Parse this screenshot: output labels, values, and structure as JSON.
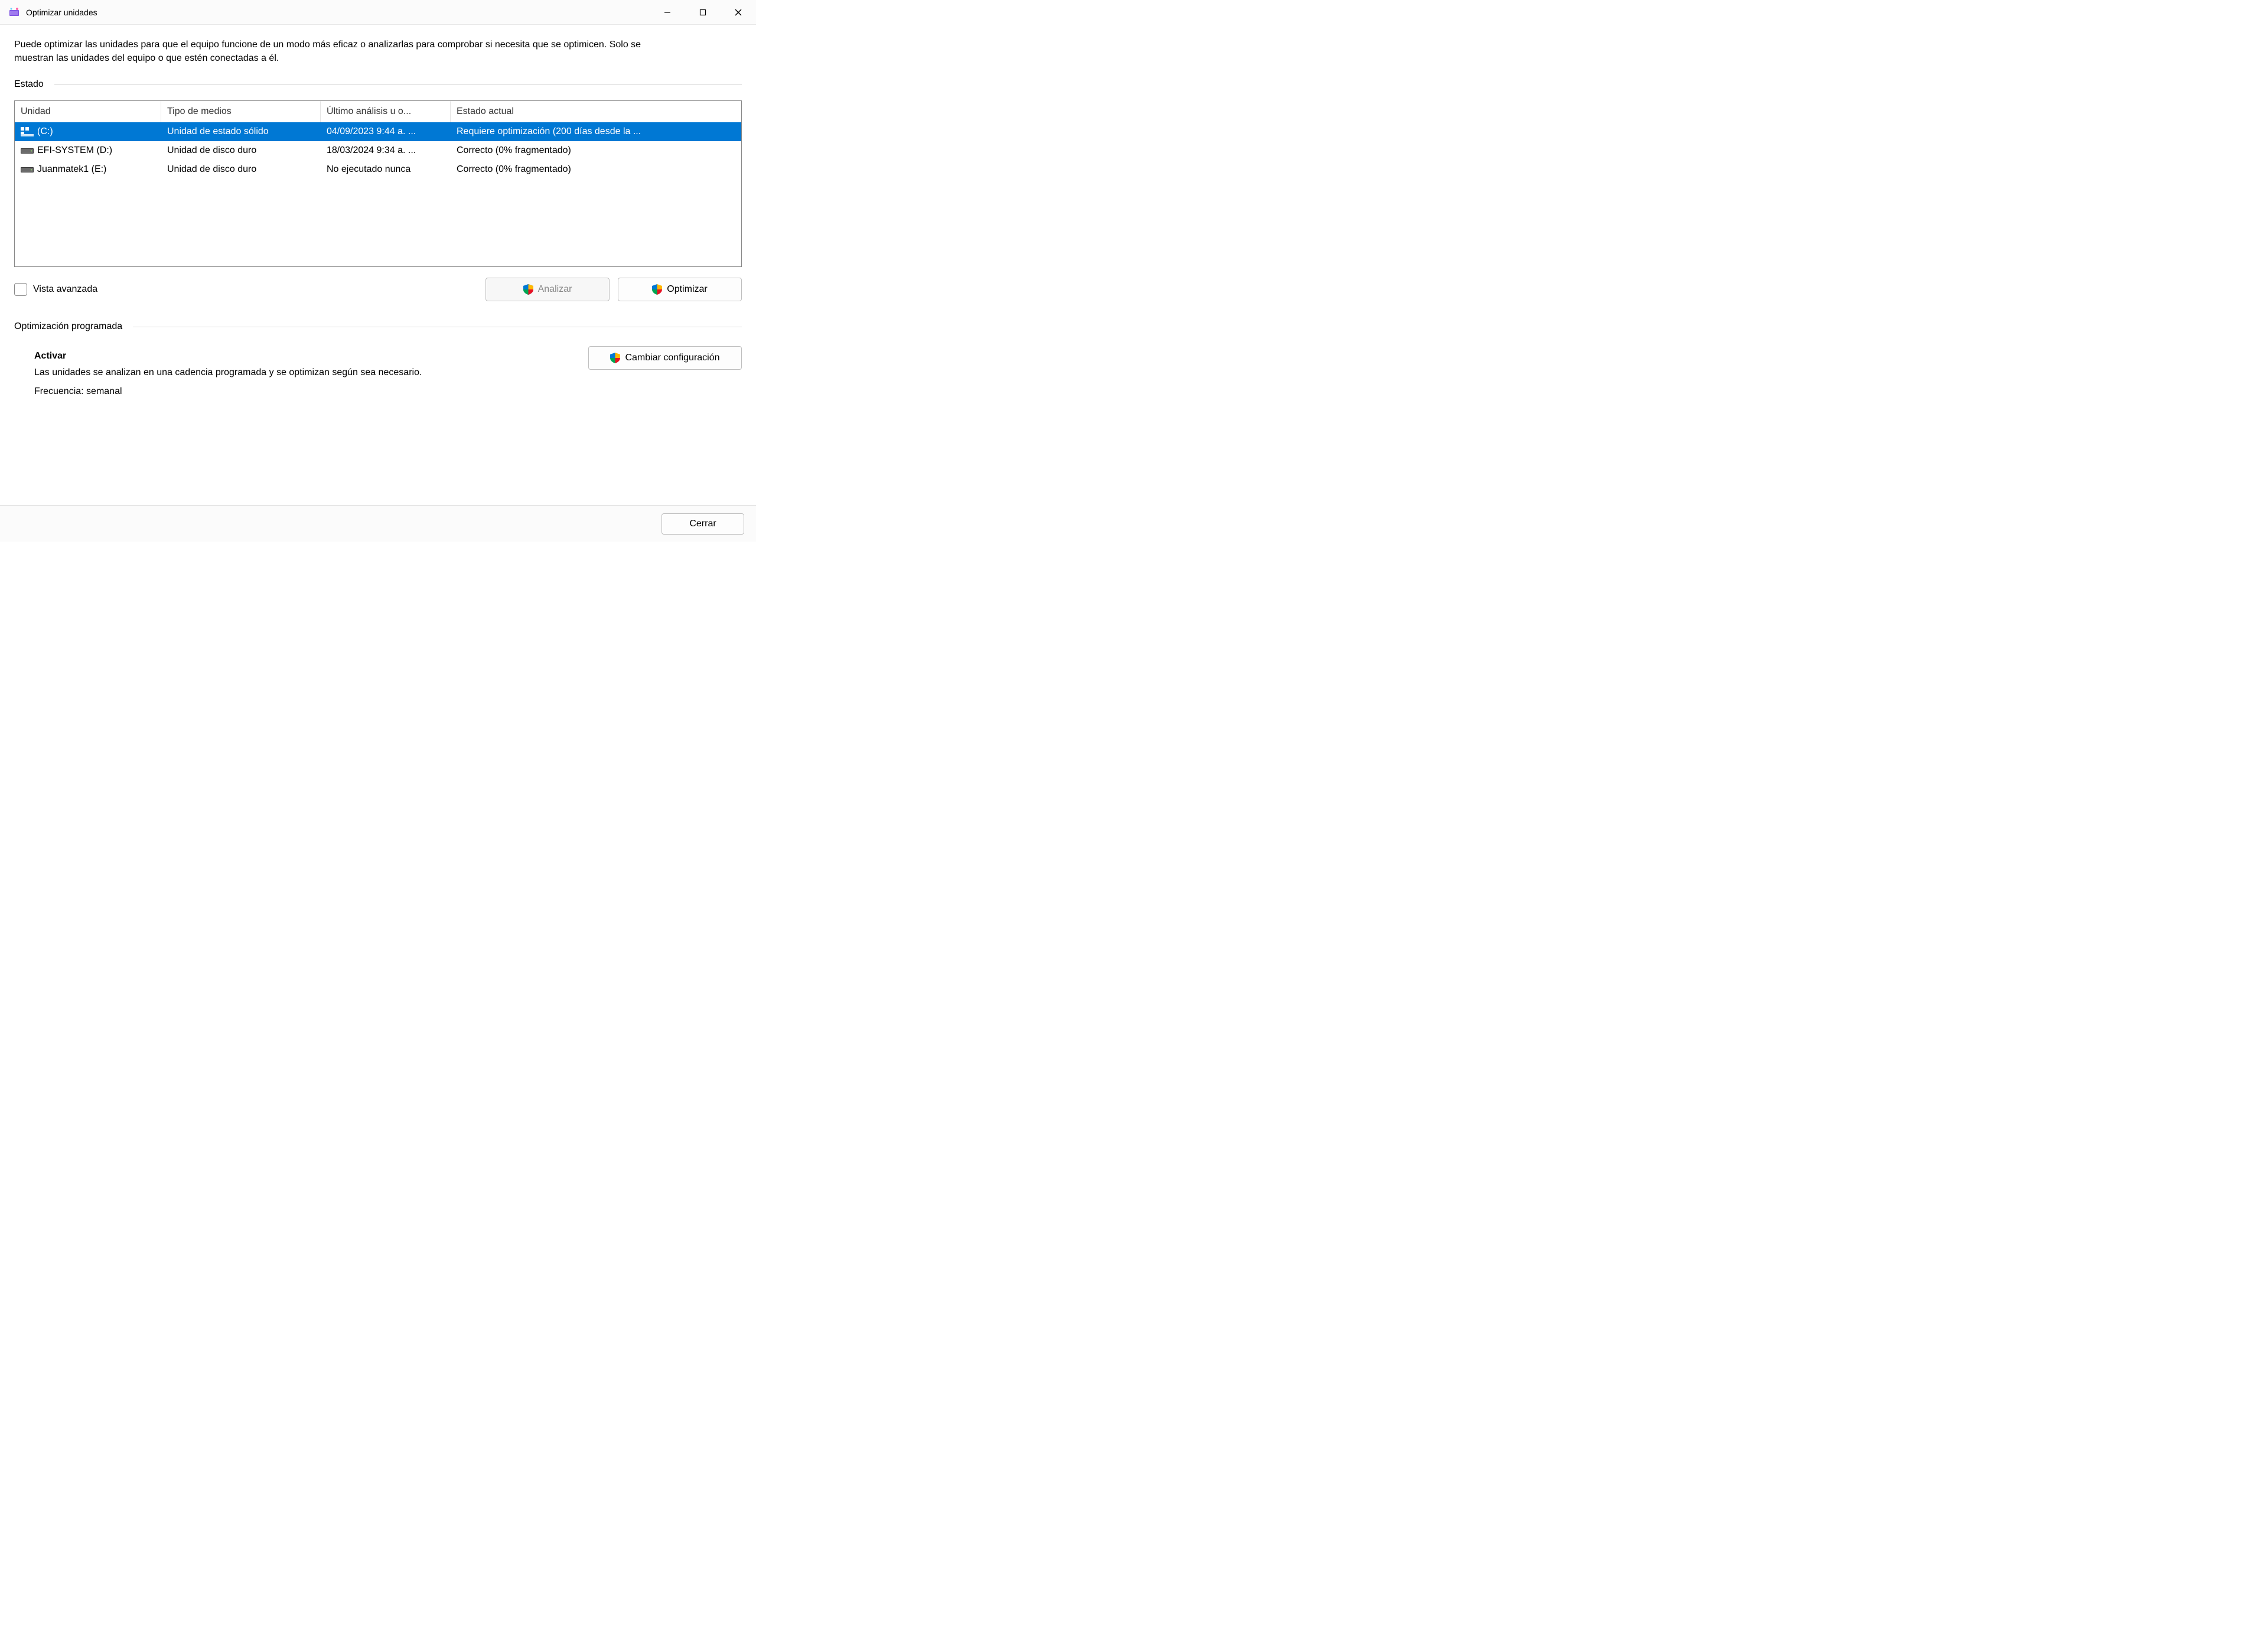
{
  "window": {
    "title": "Optimizar unidades"
  },
  "description": "Puede optimizar las unidades para que el equipo funcione de un modo más eficaz o analizarlas para comprobar si necesita que se optimicen. Solo se muestran las unidades del equipo o que estén conectadas a él.",
  "sections": {
    "status_label": "Estado",
    "scheduled_label": "Optimización programada"
  },
  "table": {
    "headers": {
      "unit": "Unidad",
      "media": "Tipo de medios",
      "last": "Último análisis u o...",
      "state": "Estado actual"
    },
    "rows": [
      {
        "icon": "ssd",
        "selected": true,
        "unit": "(C:)",
        "media": "Unidad de estado sólido",
        "last": "04/09/2023 9:44 a. ...",
        "state": "Requiere optimización (200 días desde la ..."
      },
      {
        "icon": "hdd",
        "selected": false,
        "unit": "EFI-SYSTEM (D:)",
        "media": "Unidad de disco duro",
        "last": "18/03/2024 9:34 a. ...",
        "state": "Correcto (0% fragmentado)"
      },
      {
        "icon": "hdd",
        "selected": false,
        "unit": "Juanmatek1 (E:)",
        "media": "Unidad de disco duro",
        "last": "No ejecutado nunca",
        "state": "Correcto (0% fragmentado)"
      }
    ]
  },
  "advanced_view_label": "Vista avanzada",
  "buttons": {
    "analyze": "Analizar",
    "optimize": "Optimizar",
    "change_settings": "Cambiar configuración",
    "close": "Cerrar"
  },
  "schedule": {
    "title": "Activar",
    "desc": "Las unidades se analizan en una cadencia programada y se optimizan según sea necesario.",
    "frequency": "Frecuencia: semanal"
  }
}
